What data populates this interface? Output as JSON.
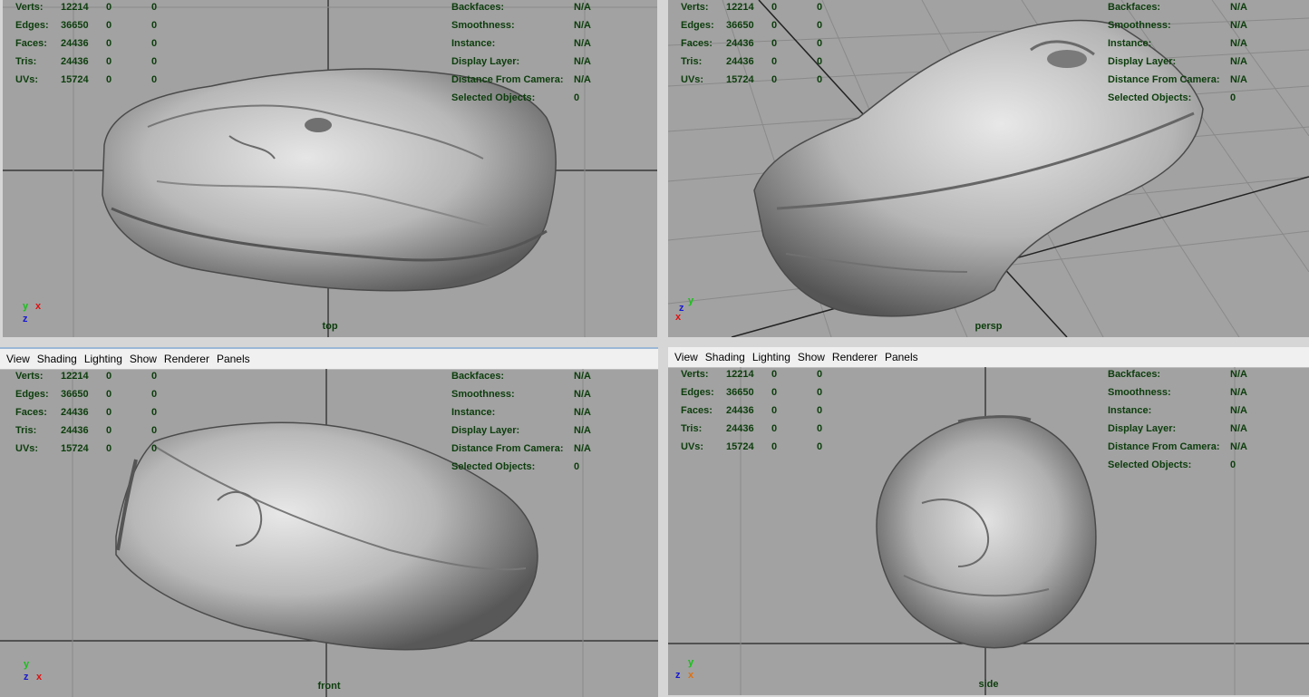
{
  "menu": [
    "View",
    "Shading",
    "Lighting",
    "Show",
    "Renderer",
    "Panels"
  ],
  "hud_left": {
    "rows": [
      {
        "label": "Verts:",
        "a": "12214",
        "b": "0",
        "c": "0"
      },
      {
        "label": "Edges:",
        "a": "36650",
        "b": "0",
        "c": "0"
      },
      {
        "label": "Faces:",
        "a": "24436",
        "b": "0",
        "c": "0"
      },
      {
        "label": "Tris:",
        "a": "24436",
        "b": "0",
        "c": "0"
      },
      {
        "label": "UVs:",
        "a": "15724",
        "b": "0",
        "c": "0"
      }
    ]
  },
  "hud_right": {
    "rows": [
      {
        "label": "Backfaces:",
        "value": "N/A"
      },
      {
        "label": "Smoothness:",
        "value": "N/A"
      },
      {
        "label": "Instance:",
        "value": "N/A"
      },
      {
        "label": "Display Layer:",
        "value": "N/A"
      },
      {
        "label": "Distance From Camera:",
        "value": "N/A"
      },
      {
        "label": "Selected Objects:",
        "value": "0"
      }
    ]
  },
  "viewports": {
    "top": {
      "camera": "top"
    },
    "persp": {
      "camera": "persp"
    },
    "front": {
      "camera": "front"
    },
    "side": {
      "camera": "side"
    }
  },
  "axes": {
    "x": "x",
    "y": "y",
    "z": "z"
  },
  "colors": {
    "viewport_bg": "#a2a2a2",
    "hud_text": "#0c3d0c",
    "x_axis": "#e01010",
    "y_axis": "#19c019",
    "z_axis": "#1818d0"
  }
}
